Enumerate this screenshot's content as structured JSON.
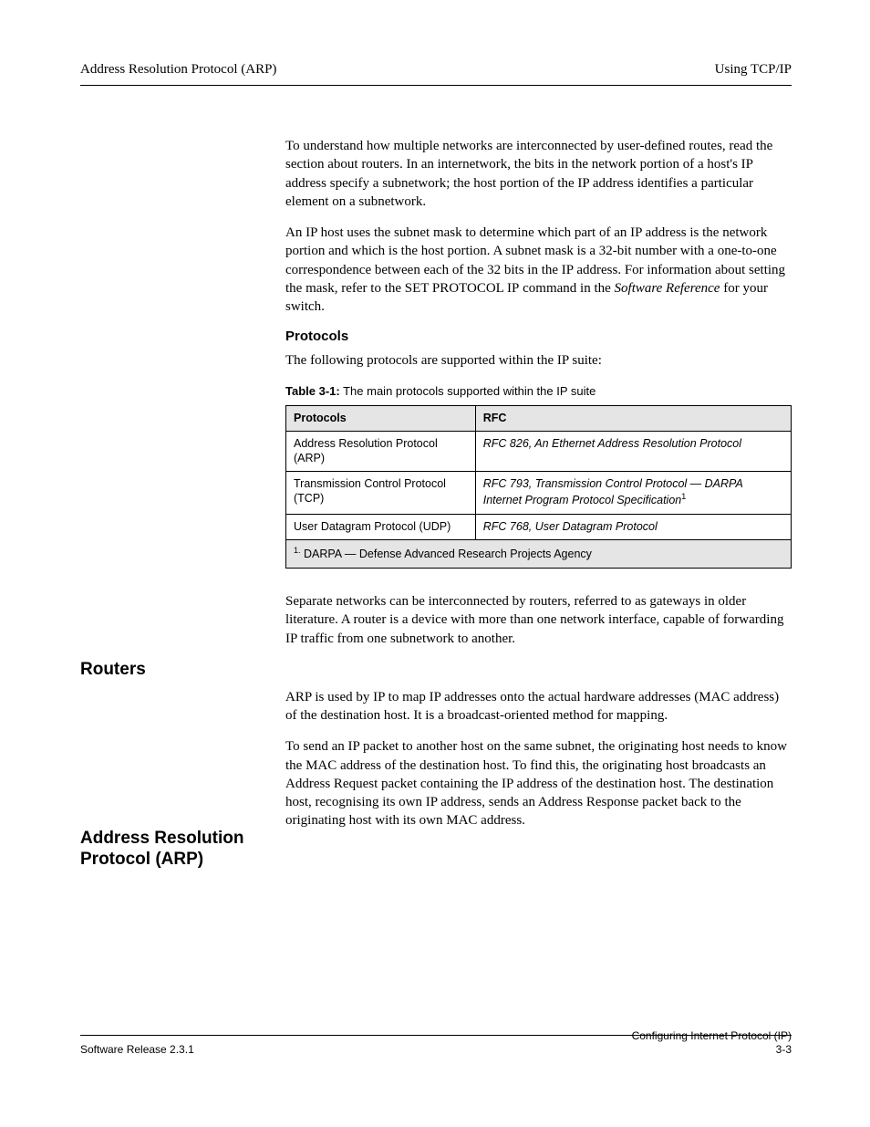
{
  "header": {
    "left": "Address Resolution Protocol (ARP)",
    "right": "Using TCP/IP"
  },
  "paragraphs": {
    "p1": "To understand how multiple networks are interconnected by user-defined routes, read the section about routers. In an internetwork, the bits in the network portion of a host's IP address specify a subnetwork; the host portion of the IP address identifies a particular element on a subnetwork.",
    "p2a": "An IP host uses the subnet mask to determine which part of an IP address is the network portion and which is the host portion. A subnet mask is a 32-bit number with a one-to-one correspondence between each of the 32 bits in the IP address. For information about setting the mask, refer to the ",
    "p2b_cmd": "SET PROTOCOL IP",
    "p2c": " command in the ",
    "p2d_em": "Software Reference",
    "p2e": " for your switch.",
    "proto_intro": "The following protocols are supported within the IP suite:",
    "routers": "Separate networks can be interconnected by routers, referred to as gateways in older literature. A router is a device with more than one network interface, capable of forwarding IP traffic from one subnetwork to another.",
    "arp1": "ARP is used by IP to map IP addresses onto the actual hardware addresses (MAC address) of the destination host. It is a broadcast-oriented method for mapping.",
    "arp2": "To send an IP packet to another host on the same subnet, the originating host needs to know the MAC address of the destination host. To find this, the originating host broadcasts an Address Request packet containing the IP address of the destination host. The destination host, recognising its own IP address, sends an Address Response packet back to the originating host with its own MAC address."
  },
  "table": {
    "caption_label": "Table 3-1:",
    "caption_text": "The main protocols supported within the IP suite",
    "headers": [
      "Protocols",
      "RFC"
    ],
    "rows": [
      [
        "Address Resolution Protocol (ARP)",
        "RFC 826, An Ethernet Address Resolution Protocol"
      ],
      [
        "Transmission Control Protocol (TCP)",
        "RFC 793, Transmission Control Protocol — DARPA Internet Program Protocol Specification"
      ],
      [
        "User Datagram Protocol (UDP)",
        "RFC 768, User Datagram Protocol"
      ]
    ],
    "footnote_sup": "1.",
    "footnote_text": "DARPA — Defense Advanced Research Projects Agency"
  },
  "sideheads": {
    "routers": "Routers",
    "arp": "Address Resolution Protocol (ARP)"
  },
  "subhead": "Protocols",
  "footer": {
    "left": "Software Release 2.3.1",
    "right_line1": "Configuring Internet Protocol (IP)",
    "right_line2": "3-3"
  }
}
